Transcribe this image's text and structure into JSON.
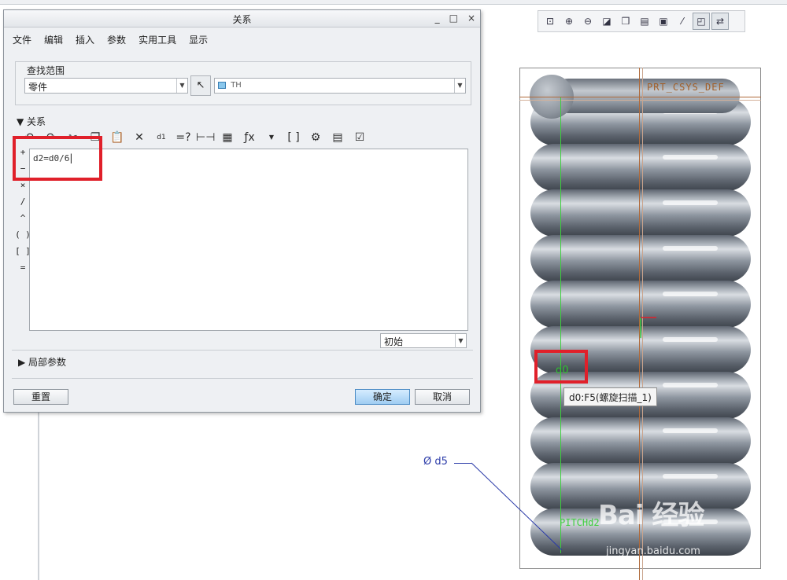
{
  "dialog": {
    "title": "关系",
    "window_buttons": {
      "minimize": "_",
      "maximize": "□",
      "close": "×"
    },
    "menu": [
      "文件",
      "编辑",
      "插入",
      "参数",
      "实用工具",
      "显示"
    ],
    "scope": {
      "label": "查找范围",
      "type_value": "零件",
      "object_value": "TH"
    },
    "relations": {
      "header": "关系",
      "operators": [
        "+",
        "−",
        "×",
        "/",
        "^",
        "( )",
        "[ ]",
        "="
      ],
      "text": "d2=d0/6",
      "state_value": "初始",
      "toolbar_fx": "ƒx"
    },
    "local_params_label": "局部参数",
    "buttons": {
      "reset": "重置",
      "ok": "确定",
      "cancel": "取消"
    }
  },
  "graphics": {
    "csys_label": "PRT_CSYS_DEF",
    "dim_d0": "d0",
    "tooltip": "d0:F5(螺旋扫描_1)",
    "dia_label": "Ø d5",
    "pitch_label": "PITCHd2",
    "coil_count": 10
  },
  "watermark": {
    "main": "Bai 经验",
    "sub": "jingyan.baidu.com"
  },
  "colors": {
    "highlight_red": "#e0202a",
    "dim_green": "#3ecf3e",
    "csys_brown": "#a2602a",
    "dia_blue": "#2a3aa8"
  },
  "icons": {
    "view_toolbar": [
      "zoom-fit-icon",
      "zoom-in-icon",
      "zoom-out-icon",
      "repaint-icon",
      "view-orient-icon",
      "saved-views-icon",
      "display-style-icon",
      "datum-display-icon",
      "spin-center-icon",
      "annotation-icon"
    ],
    "relations_toolbar": [
      "undo-icon",
      "redo-icon",
      "cut-icon",
      "copy-icon",
      "paste-icon",
      "delete-icon",
      "switch-values-icon",
      "verify-icon",
      "measure-icon",
      "sort-icon",
      "function-icon",
      "parameters-icon",
      "sort-relations-icon",
      "execute-icon",
      "verify-relations-icon"
    ]
  }
}
